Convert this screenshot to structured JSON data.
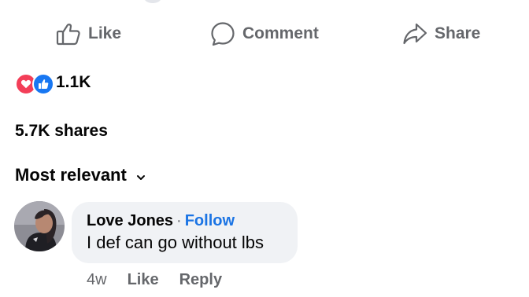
{
  "actions": {
    "like_label": "Like",
    "comment_label": "Comment",
    "share_label": "Share",
    "icon_color": "#65676b"
  },
  "reactions": {
    "count": "1.1K",
    "types": [
      "love-icon",
      "like-icon"
    ],
    "love_color": "#f33e58",
    "like_color": "#1877f2"
  },
  "shares": {
    "text": "5.7K shares"
  },
  "sort": {
    "label": "Most relevant",
    "icon": "chevron-down-icon"
  },
  "comments": [
    {
      "author": "Love Jones",
      "separator": "·",
      "follow_label": "Follow",
      "text": "I def can go without lbs",
      "time": "4w",
      "like_label": "Like",
      "reply_label": "Reply"
    }
  ],
  "colors": {
    "link": "#1b74e4",
    "secondary_text": "#65676b",
    "bubble_bg": "#f0f2f5"
  }
}
